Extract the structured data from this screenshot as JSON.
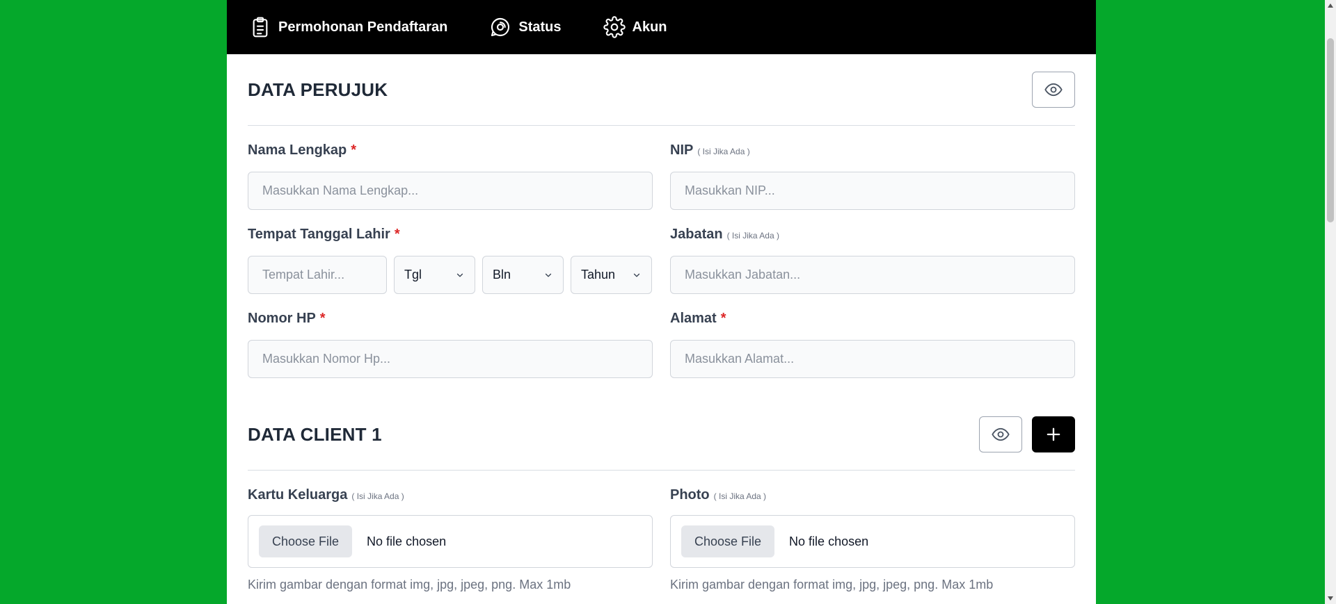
{
  "nav": {
    "items": [
      {
        "label": "Permohonan Pendaftaran",
        "icon": "clipboard-icon"
      },
      {
        "label": "Status",
        "icon": "status-icon"
      },
      {
        "label": "Akun",
        "icon": "gear-icon"
      }
    ]
  },
  "section1": {
    "title": "DATA PERUJUK",
    "fields": {
      "nama": {
        "label": "Nama Lengkap",
        "required": "*",
        "placeholder": "Masukkan Nama Lengkap..."
      },
      "nip": {
        "label": "NIP",
        "hint": "( Isi Jika Ada )",
        "placeholder": "Masukkan NIP..."
      },
      "ttl": {
        "label": "Tempat Tanggal Lahir",
        "required": "*",
        "place_placeholder": "Tempat Lahir...",
        "day": "Tgl",
        "month": "Bln",
        "year": "Tahun"
      },
      "jabatan": {
        "label": "Jabatan",
        "hint": "( Isi Jika Ada )",
        "placeholder": "Masukkan Jabatan..."
      },
      "hp": {
        "label": "Nomor HP",
        "required": "*",
        "placeholder": "Masukkan Nomor Hp..."
      },
      "alamat": {
        "label": "Alamat",
        "required": "*",
        "placeholder": "Masukkan Alamat..."
      }
    }
  },
  "section2": {
    "title": "DATA CLIENT 1",
    "fields": {
      "kk": {
        "label": "Kartu Keluarga",
        "hint": "( Isi Jika Ada )",
        "button": "Choose File",
        "status": "No file chosen",
        "help": "Kirim gambar dengan format img, jpg, jpeg, png. Max 1mb"
      },
      "photo": {
        "label": "Photo",
        "hint": "( Isi Jika Ada )",
        "button": "Choose File",
        "status": "No file chosen",
        "help": "Kirim gambar dengan format img, jpg, jpeg, png. Max 1mb"
      }
    }
  },
  "colors": {
    "background": "#05a82b",
    "nav": "#000000",
    "required": "#dc2626"
  }
}
